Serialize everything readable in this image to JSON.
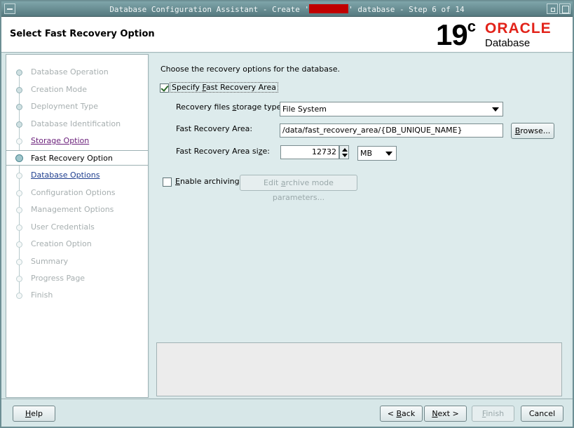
{
  "window": {
    "title_prefix": "Database Configuration Assistant - Create '",
    "title_suffix": "' database - Step 6 of 14"
  },
  "header": {
    "page_title": "Select Fast Recovery Option",
    "logo_version": "19",
    "logo_version_sup": "c",
    "logo_brand": "ORACLE",
    "logo_product": "Database"
  },
  "nav": {
    "items": [
      {
        "label": "Database Operation",
        "state": "done"
      },
      {
        "label": "Creation Mode",
        "state": "done"
      },
      {
        "label": "Deployment Type",
        "state": "done"
      },
      {
        "label": "Database Identification",
        "state": "done"
      },
      {
        "label": "Storage Option",
        "state": "visited"
      },
      {
        "label": "Fast Recovery Option",
        "state": "current"
      },
      {
        "label": "Database Options",
        "state": "link"
      },
      {
        "label": "Configuration Options",
        "state": "disabled"
      },
      {
        "label": "Management Options",
        "state": "disabled"
      },
      {
        "label": "User Credentials",
        "state": "disabled"
      },
      {
        "label": "Creation Option",
        "state": "disabled"
      },
      {
        "label": "Summary",
        "state": "disabled"
      },
      {
        "label": "Progress Page",
        "state": "disabled"
      },
      {
        "label": "Finish",
        "state": "disabled"
      }
    ]
  },
  "main": {
    "intro": "Choose the recovery options for the database.",
    "specify_fra": {
      "pre": "Specify ",
      "mnemonic": "F",
      "post": "ast Recovery Area",
      "checked": true
    },
    "storage_type_label": {
      "pre": "Recovery files ",
      "mnemonic": "s",
      "post": "torage type:"
    },
    "storage_type_value": "File System",
    "fra_label": "Fast Recovery Area:",
    "fra_value": "/data/fast_recovery_area/{DB_UNIQUE_NAME}",
    "browse_button": {
      "mnemonic": "B",
      "post": "rowse..."
    },
    "fra_size_label": {
      "pre": "Fast Recovery Area si",
      "mnemonic": "z",
      "post": "e:"
    },
    "fra_size_value": "12732",
    "fra_size_unit": "MB",
    "enable_archiving": {
      "mnemonic": "E",
      "post": "nable archiving",
      "checked": false
    },
    "edit_archive_button": {
      "pre": "Edit ",
      "mnemonic": "a",
      "post": "rchive mode parameters..."
    }
  },
  "footer": {
    "help": {
      "mnemonic": "H",
      "post": "elp"
    },
    "back": {
      "pre": "< ",
      "mnemonic": "B",
      "post": "ack"
    },
    "next": {
      "mnemonic": "N",
      "post": "ext >"
    },
    "finish": {
      "mnemonic": "F",
      "post": "inish"
    },
    "cancel": "Cancel"
  },
  "colors": {
    "oracle_red": "#e2231a",
    "redaction": "#c00000"
  }
}
